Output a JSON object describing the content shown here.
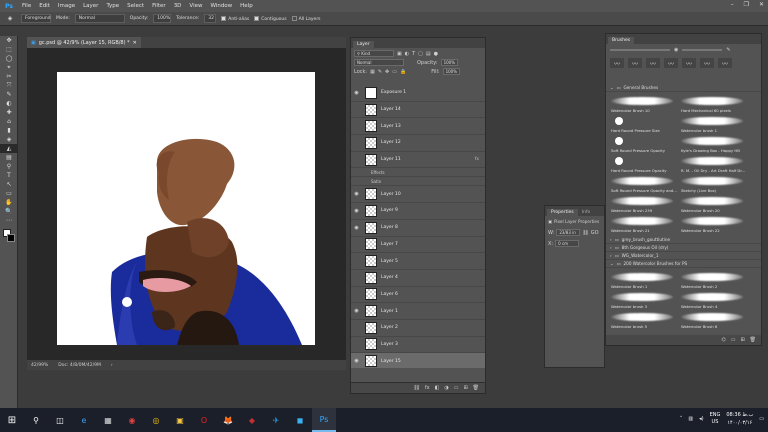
{
  "app": {
    "logo": "Ps"
  },
  "menu": [
    "File",
    "Edit",
    "Image",
    "Layer",
    "Type",
    "Select",
    "Filter",
    "3D",
    "View",
    "Window",
    "Help"
  ],
  "window_controls": [
    "–",
    "❐",
    "✕"
  ],
  "options": {
    "preset": "Foreground",
    "mode_label": "Mode:",
    "mode_value": "Normal",
    "opacity_label": "Opacity:",
    "opacity_value": "100%",
    "tolerance_label": "Tolerance:",
    "tolerance_value": "32",
    "antialias_label": "Anti-alias",
    "contiguous_label": "Contiguous",
    "all_layers_label": "All Layers"
  },
  "tools": [
    "✥",
    "⬚",
    "◯",
    "⌖",
    "✂",
    "⤧",
    "✎",
    "◐",
    "✚",
    "⌂",
    "▮",
    "◈",
    "◭",
    "▤",
    "⚲",
    "T",
    "↖",
    "▭",
    "✋",
    "🔍",
    "⋯"
  ],
  "document": {
    "tab_title": "gc.psd @ 42/9% (Layer 15, RGB/8) *",
    "zoom": "42/99%",
    "doc_size": "Doc: 4/8/0M/42/9M"
  },
  "layers_panel": {
    "tab": "Layer",
    "kind_label": "Kind",
    "blend_mode": "Normal",
    "opacity_label": "Opacity:",
    "opacity_value": "100%",
    "lock_label": "Lock:",
    "fill_label": "Fill:",
    "fill_value": "100%",
    "layers": [
      {
        "name": "Exposure 1",
        "visible": true,
        "type": "adjustment"
      },
      {
        "name": "Layer 14",
        "visible": false
      },
      {
        "name": "Layer 13",
        "visible": false
      },
      {
        "name": "Layer 12",
        "visible": false
      },
      {
        "name": "Layer 11",
        "visible": false,
        "fx": true
      },
      {
        "name": "Effects",
        "sub": true
      },
      {
        "name": "Satin",
        "sub": true
      },
      {
        "name": "Layer 10",
        "visible": true
      },
      {
        "name": "Layer 9",
        "visible": true
      },
      {
        "name": "Layer 8",
        "visible": true
      },
      {
        "name": "Layer 7",
        "visible": false
      },
      {
        "name": "Layer 5",
        "visible": false
      },
      {
        "name": "Layer 4",
        "visible": false
      },
      {
        "name": "Layer 6",
        "visible": false
      },
      {
        "name": "Layer 1",
        "visible": true
      },
      {
        "name": "Layer 2",
        "visible": false
      },
      {
        "name": "Layer 3",
        "visible": false
      },
      {
        "name": "Layer 15",
        "visible": true,
        "selected": true
      }
    ],
    "footer_icons": [
      "⛓",
      "fx",
      "◧",
      "◑",
      "▭",
      "⊞",
      "🗑"
    ]
  },
  "properties_panel": {
    "tab": "Properties",
    "tab2": "Info",
    "subtitle": "Pixel Layer Properties",
    "w_label": "W:",
    "w_value": "23/83 in",
    "go_label": "GO",
    "x_label": "X:",
    "x_value": "0 cm"
  },
  "brushes_panel": {
    "tab": "Brushes",
    "groups": [
      {
        "name": "General Brushes",
        "open": true,
        "brushes": [
          "Watercolor Brush 10",
          "Hard Mechanical 60 pixels",
          "Hard Round Pressure Size",
          "Watercolor brush 1",
          "Soft Round Pressure Opacity",
          "Kyle's Drawing Box - Happy HB",
          "Hard Round Pressure Opacity",
          "R. M. - Oil Dry - Art Draft Half Dr...",
          "Soft Round Pressure Opacity and...",
          "Sketchy (Live Box)",
          "Watercolor Brush 239",
          "Watercolor Brush 20",
          "Watercolor Brush 21",
          "Watercolor Brush 22"
        ]
      },
      {
        "name": "grey_brush_gouttiutine",
        "open": false,
        "brushes": []
      },
      {
        "name": "8th Gorgeous Oil (dry)",
        "open": false,
        "brushes": []
      },
      {
        "name": "WG_Watercolor_1",
        "open": false,
        "brushes": []
      },
      {
        "name": "200 Watercolor Brushes for PS",
        "open": true,
        "brushes": [
          "Watercolor Brush 1",
          "Watercolor Brush 2",
          "Watercolor brush 3",
          "Watercolor Brush 4",
          "Watercolor brush 5",
          "Watercolor Brush 6",
          "Watercolor Brush 7"
        ]
      }
    ]
  },
  "taskbar": {
    "icons": [
      "⊞",
      "⚲",
      "◫",
      "e",
      "▦",
      "◉",
      "◎",
      "▣",
      "O",
      "🦊",
      "◆",
      "✈",
      "◼",
      "Ps"
    ],
    "time": "08:36 ب.ظ",
    "date": "۱۴۰۰/۰۳/۱۶",
    "lang_top": "ENG",
    "lang_bottom": "US"
  },
  "colors": {
    "accent": "#31a8ff",
    "jacket": "#1a2b9b",
    "skin": "#7a4a2e"
  }
}
